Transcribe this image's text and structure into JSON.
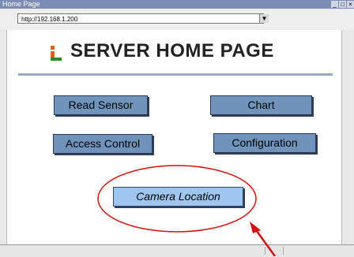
{
  "window": {
    "title": "Home Page"
  },
  "address_bar": {
    "url": "http://192.168.1.200"
  },
  "page": {
    "title": "SERVER HOME PAGE",
    "buttons": {
      "read_sensor": "Read Sensor",
      "chart": "Chart",
      "access_control": "Access Control",
      "configuration": "Configuration",
      "camera_location": "Camera Location"
    }
  },
  "colors": {
    "button": "#6f93bb",
    "highlight_button": "#9fc6ef",
    "annotation": "#d01010",
    "logo": "#e06018"
  }
}
